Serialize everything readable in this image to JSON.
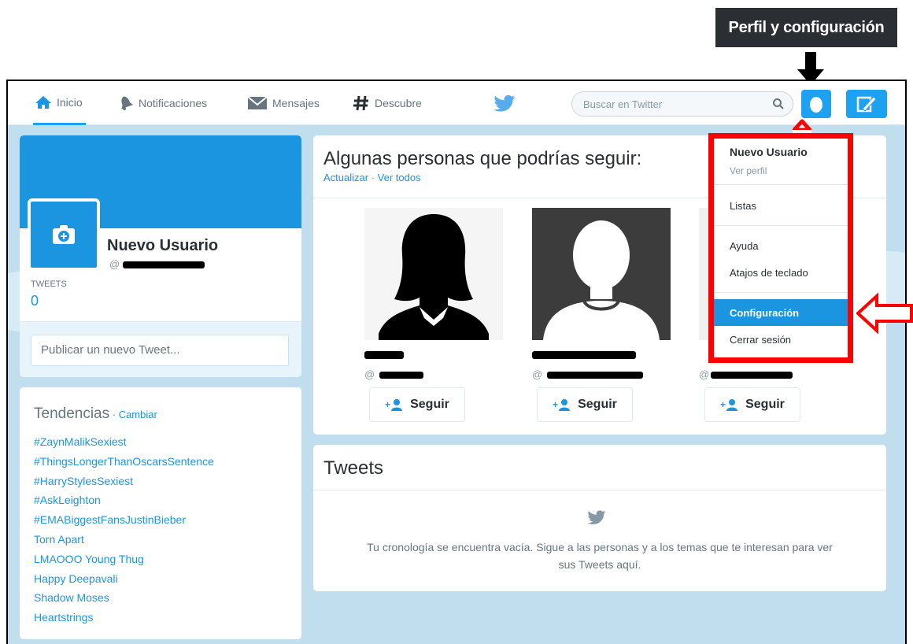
{
  "annotation": {
    "tooltip_label": "Perfil y configuración"
  },
  "nav": {
    "home": "Inicio",
    "notifications": "Notificaciones",
    "messages": "Mensajes",
    "discover": "Descubre",
    "search_placeholder": "Buscar en Twitter"
  },
  "profile": {
    "name": "Nuevo Usuario",
    "handle_prefix": "@",
    "tweets_label": "TWEETS",
    "tweets_count": "0",
    "compose_placeholder": "Publicar un nuevo Tweet..."
  },
  "trends": {
    "title": "Tendencias",
    "change_link": "Cambiar",
    "items": [
      "#ZaynMalikSexiest",
      "#ThingsLongerThanOscarsSentence",
      "#HarryStylesSexiest",
      "#AskLeighton",
      "#EMABiggestFansJustinBieber",
      "Torn Apart",
      "LMAOOO Young Thug",
      "Happy Deepavali",
      "Shadow Moses",
      "Heartstrings"
    ]
  },
  "who_to_follow": {
    "title": "Algunas personas que podrías seguir:",
    "refresh": "Actualizar",
    "separator": "·",
    "view_all": "Ver todos",
    "follow_label": "Seguir",
    "people": [
      {
        "handle_prefix": "@"
      },
      {
        "handle_prefix": "@"
      },
      {
        "handle_prefix": "@"
      }
    ]
  },
  "timeline": {
    "title": "Tweets",
    "empty_message": "Tu cronología se encuentra vacía. Sigue a las personas y a los temas que te interesan para ver sus Tweets aquí."
  },
  "dropdown": {
    "user_name": "Nuevo Usuario",
    "view_profile": "Ver perfil",
    "lists": "Listas",
    "help": "Ayuda",
    "shortcuts": "Atajos de teclado",
    "settings": "Configuración",
    "logout": "Cerrar sesión"
  },
  "colors": {
    "brand": "#1da1f2",
    "link": "#1b95e0",
    "background": "#c0deed",
    "highlight_annotation": "#ff0000"
  }
}
